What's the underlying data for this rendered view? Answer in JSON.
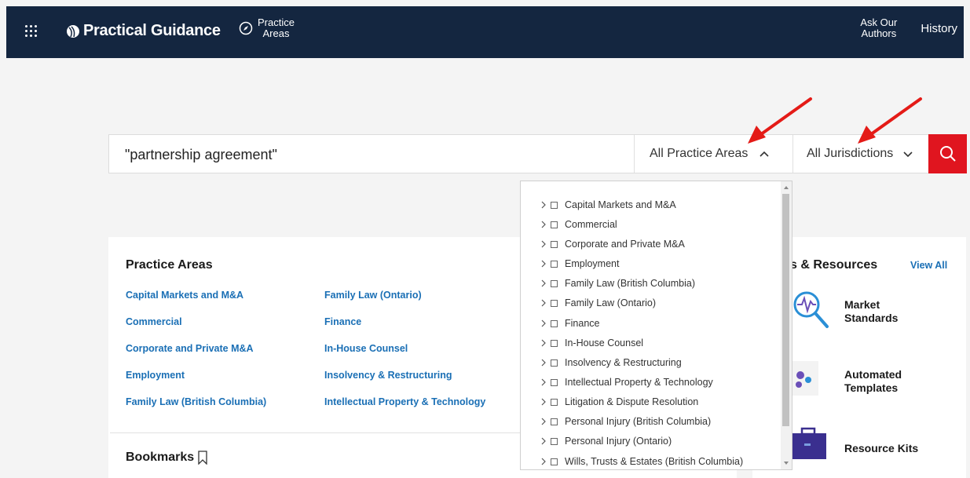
{
  "header": {
    "brand": "Practical Guidance",
    "practice_areas_line1": "Practice",
    "practice_areas_line2": "Areas",
    "ask_line1": "Ask Our",
    "ask_line2": "Authors",
    "history": "History"
  },
  "search": {
    "query": "\"partnership agreement\"",
    "practice_area_select": "All Practice Areas",
    "jurisdiction_select": "All Jurisdictions"
  },
  "dropdown": {
    "items": [
      "Capital Markets and M&A",
      "Commercial",
      "Corporate and Private M&A",
      "Employment",
      "Family Law (British Columbia)",
      "Family Law (Ontario)",
      "Finance",
      "In-House Counsel",
      "Insolvency & Restructuring",
      "Intellectual Property & Technology",
      "Litigation & Dispute Resolution",
      "Personal Injury (British Columbia)",
      "Personal Injury (Ontario)",
      "Wills, Trusts & Estates (British Columbia)"
    ]
  },
  "practice_areas": {
    "title": "Practice Areas",
    "col1": [
      "Capital Markets and M&A",
      "Commercial",
      "Corporate and Private M&A",
      "Employment",
      "Family Law (British Columbia)"
    ],
    "col2": [
      "Family Law (Ontario)",
      "Finance",
      "In-House Counsel",
      "Insolvency & Restructuring",
      "Intellectual Property & Technology"
    ]
  },
  "bookmarks": {
    "title": "Bookmarks"
  },
  "tools": {
    "title": "s & Resources",
    "view_all": "View All",
    "items": [
      {
        "line1": "Market",
        "line2": "Standards"
      },
      {
        "line1": "Automated",
        "line2": "Templates"
      },
      {
        "line1": "Resource Kits",
        "line2": ""
      }
    ]
  },
  "colors": {
    "header_bg": "#142640",
    "accent_red": "#e0151f",
    "link_blue": "#1a6fb5"
  }
}
